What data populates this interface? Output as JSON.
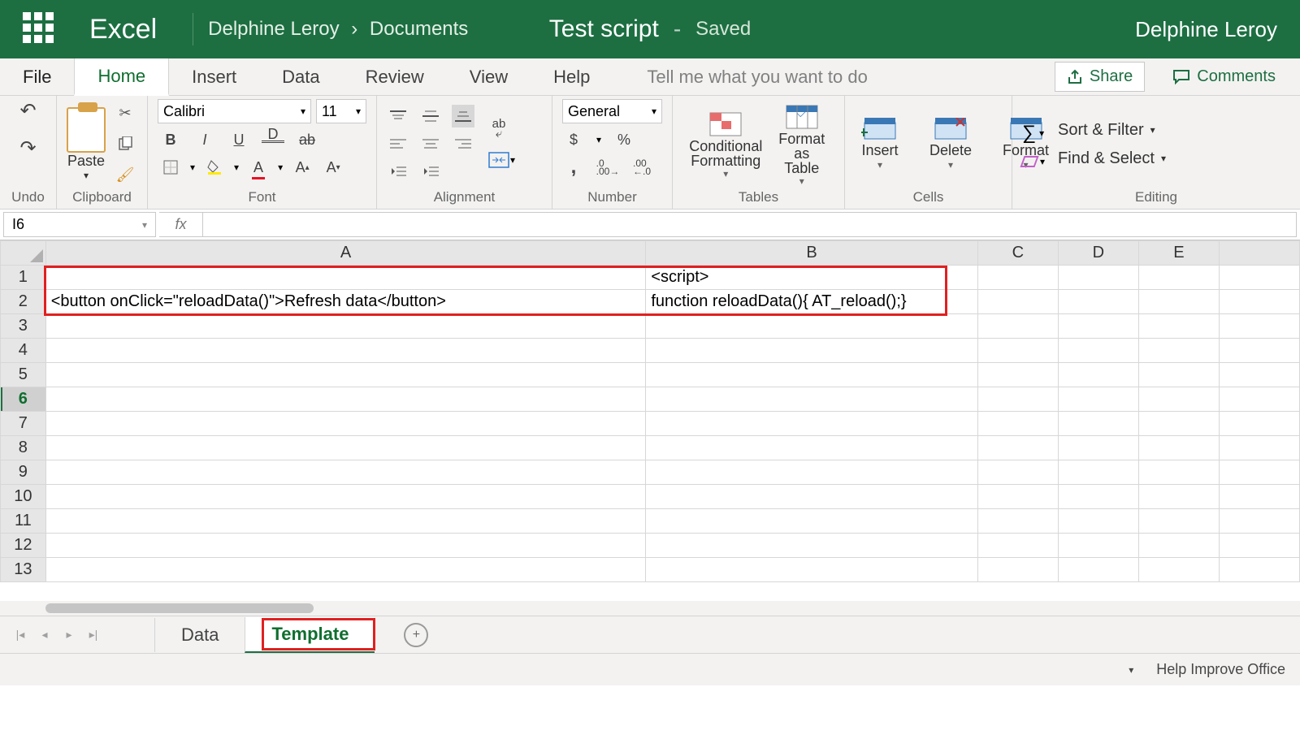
{
  "titlebar": {
    "app": "Excel",
    "user_path_1": "Delphine Leroy",
    "user_path_2": "Documents",
    "docname": "Test script",
    "saved": "Saved",
    "account": "Delphine Leroy"
  },
  "tabs": {
    "file": "File",
    "home": "Home",
    "insert": "Insert",
    "data": "Data",
    "review": "Review",
    "view": "View",
    "help": "Help",
    "tellme": "Tell me what you want to do",
    "share": "Share",
    "comments": "Comments"
  },
  "ribbon": {
    "undo": "Undo",
    "clipboard": {
      "paste": "Paste",
      "label": "Clipboard"
    },
    "font": {
      "name": "Calibri",
      "size": "11",
      "label": "Font"
    },
    "alignment": {
      "label": "Alignment"
    },
    "number": {
      "format": "General",
      "label": "Number"
    },
    "tables": {
      "cond": "Conditional Formatting",
      "fmt": "Format as Table",
      "label": "Tables"
    },
    "cells": {
      "insert": "Insert",
      "delete": "Delete",
      "format": "Format",
      "label": "Cells"
    },
    "editing": {
      "sort": "Sort & Filter",
      "find": "Find & Select",
      "label": "Editing"
    }
  },
  "namebox": "I6",
  "columns": [
    "A",
    "B",
    "C",
    "D",
    "E"
  ],
  "rows_shown": 13,
  "cells": {
    "B1": "<script>",
    "A2": "<button onClick=\"reloadData()\">Refresh data</button>",
    "B2": "function reloadData(){ AT_reload();}"
  },
  "sheets": {
    "s1": "Data",
    "s2": "Template"
  },
  "status": {
    "help": "Help Improve Office"
  }
}
